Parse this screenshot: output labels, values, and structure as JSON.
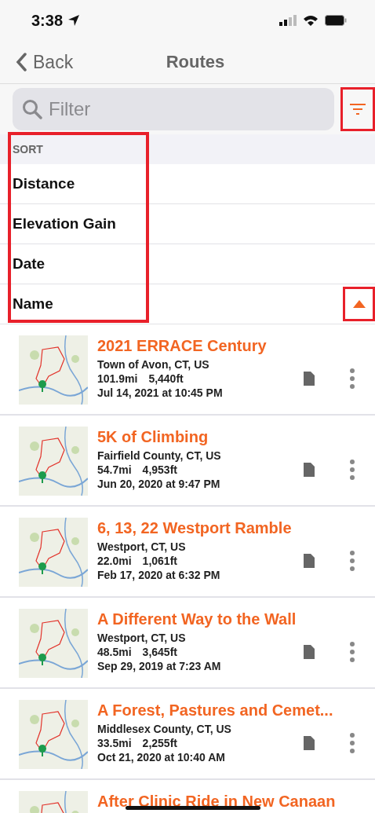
{
  "status_bar": {
    "time": "3:38"
  },
  "nav": {
    "back": "Back",
    "title": "Routes"
  },
  "filter": {
    "placeholder": "Filter",
    "button_highlighted": true
  },
  "sort": {
    "header": "SORT",
    "highlighted": true,
    "direction_highlighted": true,
    "options": [
      {
        "label": "Distance",
        "selected": false
      },
      {
        "label": "Elevation Gain",
        "selected": false
      },
      {
        "label": "Date",
        "selected": false
      },
      {
        "label": "Name",
        "selected": true
      }
    ]
  },
  "routes": [
    {
      "title": "2021 ERRACE Century",
      "place": "Town of Avon, CT, US",
      "distance": "101.9mi",
      "elevation": "5,440ft",
      "date": "Jul 14, 2021 at 10:45 PM"
    },
    {
      "title": "5K of Climbing",
      "place": "Fairfield County, CT, US",
      "distance": "54.7mi",
      "elevation": "4,953ft",
      "date": "Jun 20, 2020 at 9:47 PM"
    },
    {
      "title": "6, 13, 22 Westport Ramble",
      "place": "Westport, CT, US",
      "distance": "22.0mi",
      "elevation": "1,061ft",
      "date": "Feb 17, 2020 at 6:32 PM"
    },
    {
      "title": "A Different Way to the Wall",
      "place": "Westport, CT, US",
      "distance": "48.5mi",
      "elevation": "3,645ft",
      "date": "Sep 29, 2019 at 7:23 AM"
    },
    {
      "title": "A Forest, Pastures and Cemet...",
      "place": "Middlesex County, CT, US",
      "distance": "33.5mi",
      "elevation": "2,255ft",
      "date": "Oct 21, 2020 at 10:40 AM"
    },
    {
      "title": "After Clinic Ride in New Canaan"
    }
  ]
}
